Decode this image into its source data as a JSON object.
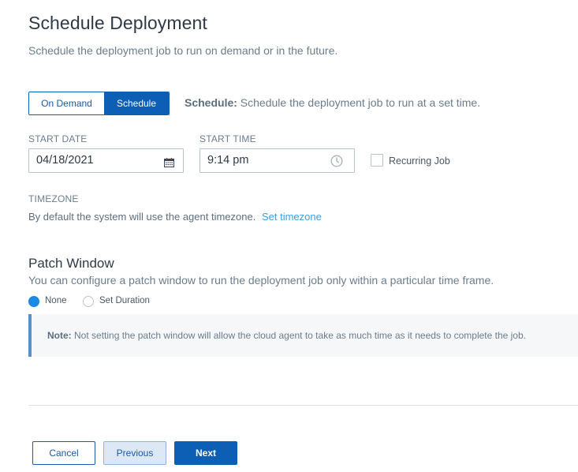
{
  "header": {
    "title": "Schedule Deployment",
    "subtitle": "Schedule the deployment job to run on demand or in the future."
  },
  "mode": {
    "options": [
      "On Demand",
      "Schedule"
    ],
    "selected": "Schedule",
    "description_label": "Schedule:",
    "description_text": " Schedule the deployment job to run at a set time."
  },
  "start_date": {
    "label": "START DATE",
    "value": "04/18/2021",
    "icon": "calendar-icon"
  },
  "start_time": {
    "label": "START TIME",
    "value": "9:14 pm",
    "icon": "clock-icon"
  },
  "recurring": {
    "label": "Recurring Job",
    "checked": false
  },
  "timezone": {
    "label": "TIMEZONE",
    "text": "By default the system will use the agent timezone.",
    "link": "Set timezone"
  },
  "patch_window": {
    "title": "Patch Window",
    "description": "You can configure a patch window to run the deployment job only within a particular time frame.",
    "options": [
      "None",
      "Set Duration"
    ],
    "selected": "None",
    "note_label": "Note:",
    "note_text": " Not setting the patch window will allow the cloud agent to take as much time as it needs to complete the job."
  },
  "footer": {
    "cancel": "Cancel",
    "previous": "Previous",
    "next": "Next"
  },
  "colors": {
    "primary": "#0c5fb4",
    "link": "#3a9fe0",
    "radio_selected": "#1a8ae5",
    "note_border": "#5b8fc9"
  }
}
